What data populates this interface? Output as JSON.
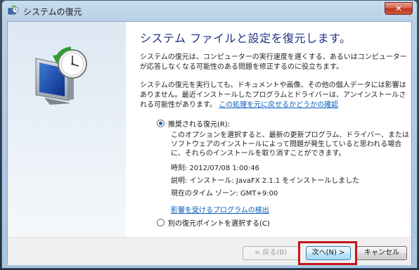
{
  "window": {
    "title": "システムの復元"
  },
  "main": {
    "heading": "システム ファイルと設定を復元します。",
    "paragraph1": "システムの復元は、コンピューターの実行速度を遅くする、あるいはコンピューターが応答しなくなる可能性のある問題を修正するのに役立ちます。",
    "paragraph2": "システムの復元を実行しても、ドキュメントや画像、その他の個人データには影響はありません。最近インストールしたプログラムとドライバーは、アンインストールされる可能性があります。",
    "undo_link": "この処理を元に戻せるかどうかの確認"
  },
  "options": {
    "recommended_label": "推奨される復元(R):",
    "recommended_desc": "このオプションを選択すると、最新の更新プログラム、ドライバー、またはソフトウェアのインストールによって問題が発生していると思われる場合に、それらのインストールを取り消すことができます。",
    "time_line": "時刻: 2012/07/08 1:00:46",
    "desc_line": "説明: インストール: JavaFX 2.1.1 をインストールしました",
    "tz_line": "現在のタイム ゾーン: GMT+9:00",
    "affected_link": "影響を受けるプログラムの検出",
    "other_label": "別の復元ポイントを選択する(C)"
  },
  "footer": {
    "back_label": "< 戻る(B)",
    "next_label": "次へ(N) >",
    "cancel_label": "キャンセル"
  },
  "icons": {
    "close": "close-icon",
    "app": "system-restore-icon"
  },
  "colors": {
    "heading": "#1e3287",
    "link": "#0b5cc0",
    "highlight": "#c4161c"
  }
}
